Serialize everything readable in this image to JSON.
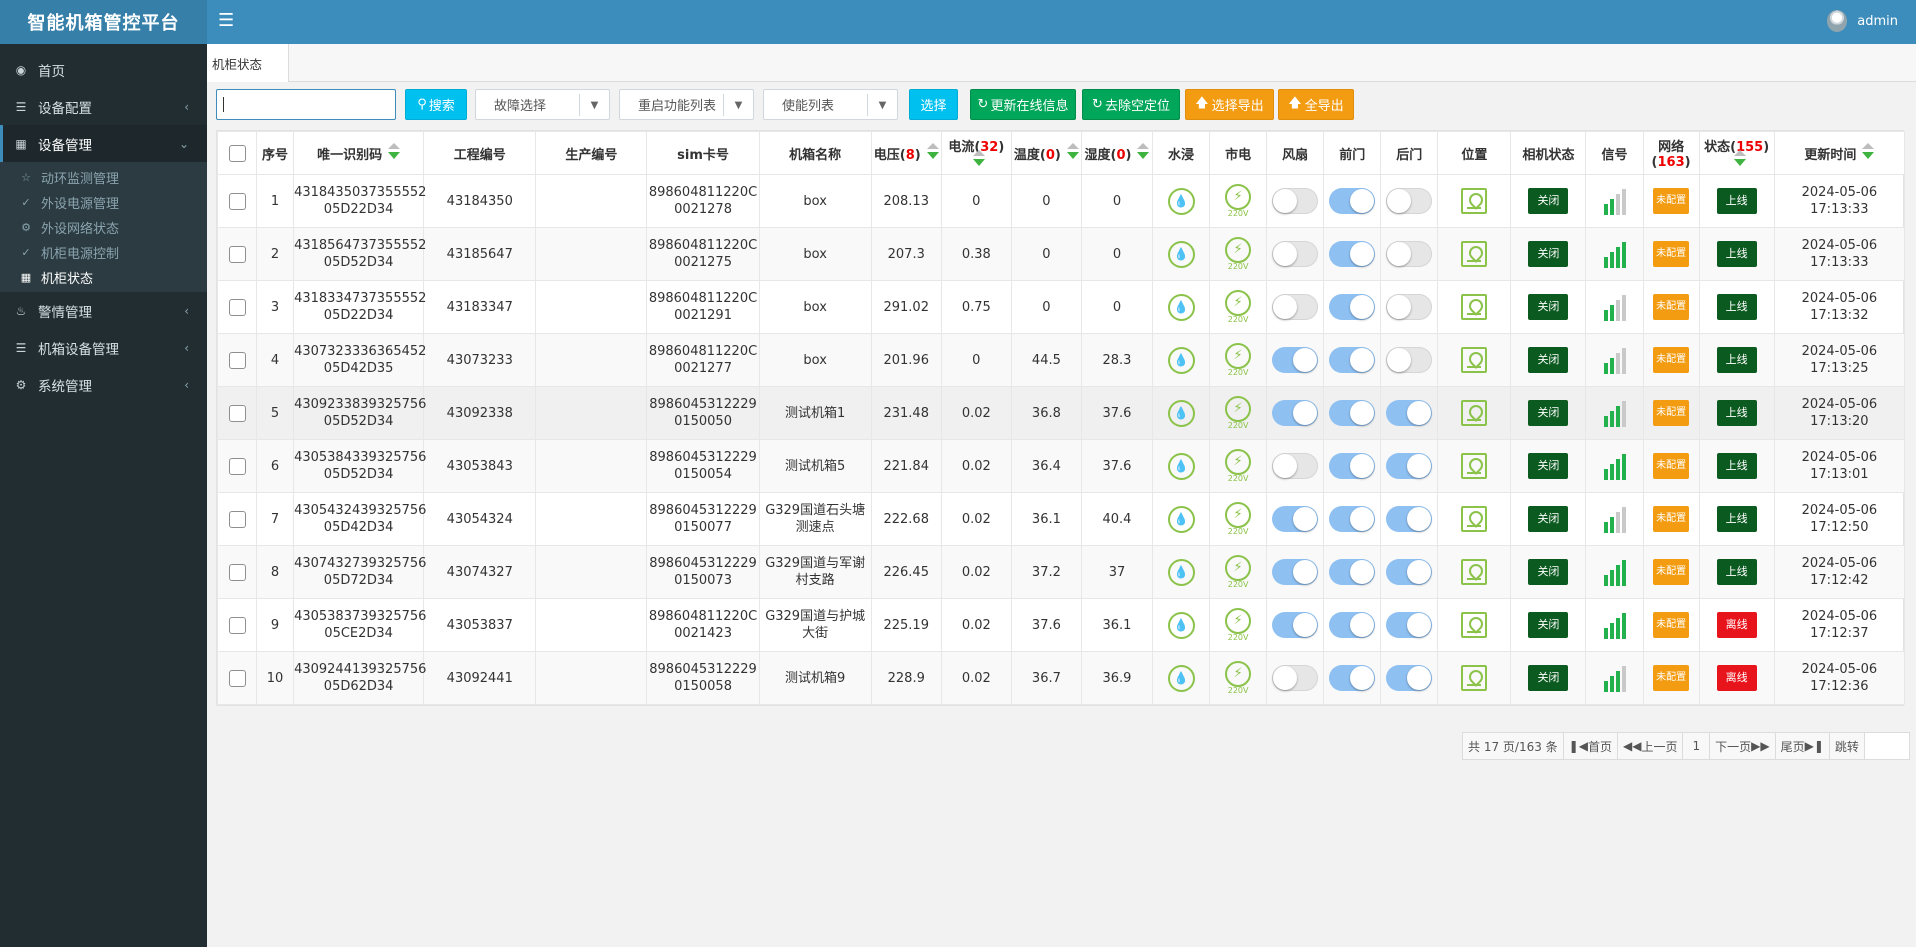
{
  "app": {
    "title": "智能机箱管控平台",
    "menu_icon": "bars-icon"
  },
  "user": {
    "name": "admin"
  },
  "sidebar": {
    "home": {
      "label": "首页",
      "icon": "dashboard-icon"
    },
    "device_config": {
      "label": "设备配置",
      "icon": "database-icon"
    },
    "device_mgmt": {
      "label": "设备管理",
      "icon": "table-icon"
    },
    "sub": [
      {
        "label": "动环监测管理",
        "icon": "star-icon"
      },
      {
        "label": "外设电源管理",
        "icon": "plug-icon"
      },
      {
        "label": "外设网络状态",
        "icon": "gear-icon"
      },
      {
        "label": "机柜电源控制",
        "icon": "plug-icon"
      },
      {
        "label": "机柜状态",
        "icon": "table-icon"
      }
    ],
    "alarm": {
      "label": "警情管理",
      "icon": "bell-icon"
    },
    "box_device": {
      "label": "机箱设备管理",
      "icon": "database-icon"
    },
    "system": {
      "label": "系统管理",
      "icon": "gear-icon"
    }
  },
  "tab": {
    "label": "机柜状态"
  },
  "toolbar": {
    "search_value": "",
    "search_btn": "搜索",
    "fault_select": "故障选择",
    "restart_select": "重启功能列表",
    "enable_select": "使能列表",
    "choose_btn": "选择",
    "update_online_btn": "更新在线信息",
    "clear_location_btn": "去除空定位",
    "export_selected_btn": "选择导出",
    "export_all_btn": "全导出"
  },
  "table": {
    "headers": {
      "seq": "序号",
      "uid": "唯一识别码",
      "project": "工程编号",
      "produce": "生产编号",
      "sim": "sim卡号",
      "box_name": "机箱名称",
      "voltage": "电压(",
      "voltage_count": "8",
      "current": "电流(",
      "current_count": "32",
      "temp": "温度(",
      "temp_count": "0",
      "humidity": "湿度(",
      "humidity_count": "0",
      "close_paren": ")",
      "water": "水浸",
      "mains": "市电",
      "fan": "风扇",
      "front_door": "前门",
      "back_door": "后门",
      "location": "位置",
      "camera": "相机状态",
      "signal": "信号",
      "network": "网络(",
      "network_count": "163",
      "status": "状态(",
      "status_count": "155",
      "update_time": "更新时间"
    },
    "mains_voltage_label": "220V",
    "rows": [
      {
        "seq": "1",
        "uid1": "4318435037355552",
        "uid2": "05D22D34",
        "project": "43184350",
        "produce": "",
        "sim1": "898604811220C",
        "sim2": "0021278",
        "name1": "box",
        "name2": "",
        "voltage": "208.13",
        "current": "0",
        "temp": "0",
        "humidity": "0",
        "fan_on": false,
        "front_on": true,
        "back_on": false,
        "camera": "关闭",
        "signal": 2,
        "network": "未配置",
        "status": "上线",
        "online": true,
        "date": "2024-05-06",
        "time": "17:13:33"
      },
      {
        "seq": "2",
        "uid1": "4318564737355552",
        "uid2": "05D52D34",
        "project": "43185647",
        "produce": "",
        "sim1": "898604811220C",
        "sim2": "0021275",
        "name1": "box",
        "name2": "",
        "voltage": "207.3",
        "current": "0.38",
        "temp": "0",
        "humidity": "0",
        "fan_on": false,
        "front_on": true,
        "back_on": false,
        "camera": "关闭",
        "signal": 4,
        "network": "未配置",
        "status": "上线",
        "online": true,
        "date": "2024-05-06",
        "time": "17:13:33"
      },
      {
        "seq": "3",
        "uid1": "4318334737355552",
        "uid2": "05D22D34",
        "project": "43183347",
        "produce": "",
        "sim1": "898604811220C",
        "sim2": "0021291",
        "name1": "box",
        "name2": "",
        "voltage": "291.02",
        "current": "0.75",
        "temp": "0",
        "humidity": "0",
        "fan_on": false,
        "front_on": true,
        "back_on": false,
        "camera": "关闭",
        "signal": 2,
        "network": "未配置",
        "status": "上线",
        "online": true,
        "date": "2024-05-06",
        "time": "17:13:32"
      },
      {
        "seq": "4",
        "uid1": "4307323336365452",
        "uid2": "05D42D35",
        "project": "43073233",
        "produce": "",
        "sim1": "898604811220C",
        "sim2": "0021277",
        "name1": "box",
        "name2": "",
        "voltage": "201.96",
        "current": "0",
        "temp": "44.5",
        "humidity": "28.3",
        "fan_on": true,
        "front_on": true,
        "back_on": false,
        "camera": "关闭",
        "signal": 2,
        "network": "未配置",
        "status": "上线",
        "online": true,
        "date": "2024-05-06",
        "time": "17:13:25"
      },
      {
        "seq": "5",
        "uid1": "4309233839325756",
        "uid2": "05D52D34",
        "project": "43092338",
        "produce": "",
        "sim1": "8986045312229",
        "sim2": "0150050",
        "name1": "测试机箱1",
        "name2": "",
        "voltage": "231.48",
        "current": "0.02",
        "temp": "36.8",
        "humidity": "37.6",
        "fan_on": true,
        "front_on": true,
        "back_on": true,
        "camera": "关闭",
        "signal": 3,
        "network": "未配置",
        "status": "上线",
        "online": true,
        "date": "2024-05-06",
        "time": "17:13:20"
      },
      {
        "seq": "6",
        "uid1": "4305384339325756",
        "uid2": "05D52D34",
        "project": "43053843",
        "produce": "",
        "sim1": "8986045312229",
        "sim2": "0150054",
        "name1": "测试机箱5",
        "name2": "",
        "voltage": "221.84",
        "current": "0.02",
        "temp": "36.4",
        "humidity": "37.6",
        "fan_on": false,
        "front_on": true,
        "back_on": true,
        "camera": "关闭",
        "signal": 4,
        "network": "未配置",
        "status": "上线",
        "online": true,
        "date": "2024-05-06",
        "time": "17:13:01"
      },
      {
        "seq": "7",
        "uid1": "4305432439325756",
        "uid2": "05D42D34",
        "project": "43054324",
        "produce": "",
        "sim1": "8986045312229",
        "sim2": "0150077",
        "name1": "G329国道石头塘",
        "name2": "测速点",
        "voltage": "222.68",
        "current": "0.02",
        "temp": "36.1",
        "humidity": "40.4",
        "fan_on": true,
        "front_on": true,
        "back_on": true,
        "camera": "关闭",
        "signal": 2,
        "network": "未配置",
        "status": "上线",
        "online": true,
        "date": "2024-05-06",
        "time": "17:12:50"
      },
      {
        "seq": "8",
        "uid1": "4307432739325756",
        "uid2": "05D72D34",
        "project": "43074327",
        "produce": "",
        "sim1": "8986045312229",
        "sim2": "0150073",
        "name1": "G329国道与军谢",
        "name2": "村支路",
        "voltage": "226.45",
        "current": "0.02",
        "temp": "37.2",
        "humidity": "37",
        "fan_on": true,
        "front_on": true,
        "back_on": true,
        "camera": "关闭",
        "signal": 4,
        "network": "未配置",
        "status": "上线",
        "online": true,
        "date": "2024-05-06",
        "time": "17:12:42"
      },
      {
        "seq": "9",
        "uid1": "4305383739325756",
        "uid2": "05CE2D34",
        "project": "43053837",
        "produce": "",
        "sim1": "898604811220C",
        "sim2": "0021423",
        "name1": "G329国道与护城",
        "name2": "大街",
        "voltage": "225.19",
        "current": "0.02",
        "temp": "37.6",
        "humidity": "36.1",
        "fan_on": true,
        "front_on": true,
        "back_on": true,
        "camera": "关闭",
        "signal": 4,
        "network": "未配置",
        "status": "离线",
        "online": false,
        "date": "2024-05-06",
        "time": "17:12:37"
      },
      {
        "seq": "10",
        "uid1": "4309244139325756",
        "uid2": "05D62D34",
        "project": "43092441",
        "produce": "",
        "sim1": "8986045312229",
        "sim2": "0150058",
        "name1": "测试机箱9",
        "name2": "",
        "voltage": "228.9",
        "current": "0.02",
        "temp": "36.7",
        "humidity": "36.9",
        "fan_on": false,
        "front_on": true,
        "back_on": true,
        "camera": "关闭",
        "signal": 3,
        "network": "未配置",
        "status": "离线",
        "online": false,
        "date": "2024-05-06",
        "time": "17:12:36"
      }
    ]
  },
  "pagination": {
    "summary": "共 17 页/163 条",
    "first": "首页",
    "prev": "上一页",
    "current": "1",
    "next": "下一页",
    "last": "尾页",
    "jump": "跳转",
    "jump_value": ""
  },
  "colors": {
    "header": "#3c8dbc",
    "sidebar": "#222d32",
    "online": "#0b5a20",
    "offline": "#e8141c",
    "unconfigured": "#f39c12"
  }
}
